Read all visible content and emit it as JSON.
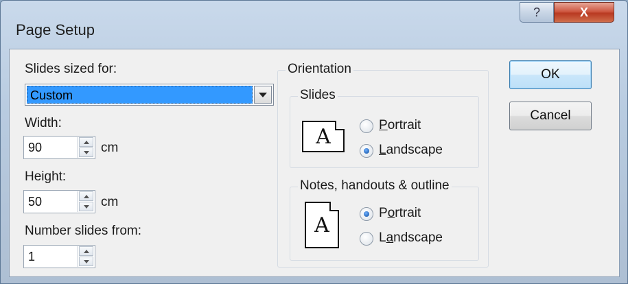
{
  "window": {
    "title": "Page Setup",
    "help_label": "?",
    "close_label": "X"
  },
  "slides_sized_for": {
    "label": "Slides sized for:",
    "value": "Custom"
  },
  "width": {
    "label": "Width:",
    "value": "90",
    "unit": "cm"
  },
  "height": {
    "label": "Height:",
    "value": "50",
    "unit": "cm"
  },
  "number_slides_from": {
    "label": "Number slides from:",
    "value": "1"
  },
  "orientation": {
    "label": "Orientation",
    "slides": {
      "label": "Slides",
      "icon_letter": "A",
      "portrait_label": "Portrait",
      "landscape_label": "Landscape",
      "selected": "Landscape"
    },
    "notes": {
      "label": "Notes, handouts & outline",
      "icon_letter": "A",
      "portrait_label": "Portrait",
      "landscape_label": "Landscape",
      "selected": "Portrait"
    }
  },
  "buttons": {
    "ok": "OK",
    "cancel": "Cancel"
  },
  "colors": {
    "selection": "#3399ff",
    "close_button": "#c8452c",
    "default_button_border": "#3c7fb1"
  }
}
